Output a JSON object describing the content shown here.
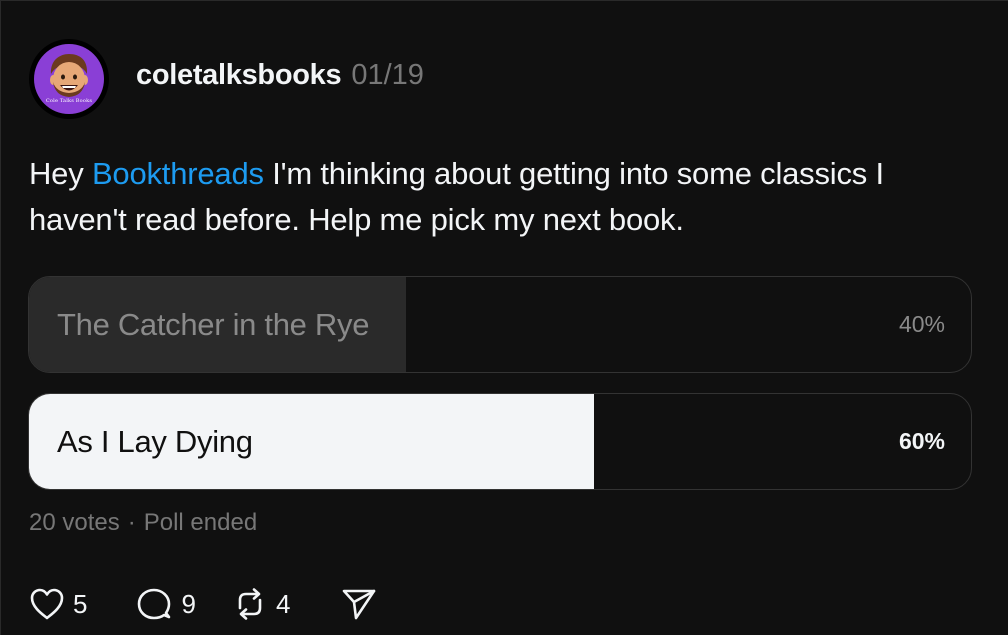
{
  "post": {
    "username": "coletalksbooks",
    "date": "01/19",
    "avatar_text": "Cole Talks Books",
    "text_before": "Hey ",
    "mention": "Bookthreads",
    "text_after": " I'm thinking about getting into some classics I haven't read before.  Help me pick my next book."
  },
  "poll": {
    "options": [
      {
        "label": "The Catcher in the Rye",
        "percent_label": "40%",
        "percent": 40
      },
      {
        "label": "As I Lay Dying",
        "percent_label": "60%",
        "percent": 60
      }
    ],
    "votes": "20 votes",
    "separator": "·",
    "status": "Poll ended"
  },
  "actions": {
    "likes": "5",
    "replies": "9",
    "reposts": "4"
  },
  "icons": {
    "like": "heart-icon",
    "reply": "comment-icon",
    "repost": "repost-icon",
    "share": "send-icon"
  },
  "colors": {
    "mention": "#1d9bf0",
    "avatar_bg": "#8a3fd6"
  }
}
